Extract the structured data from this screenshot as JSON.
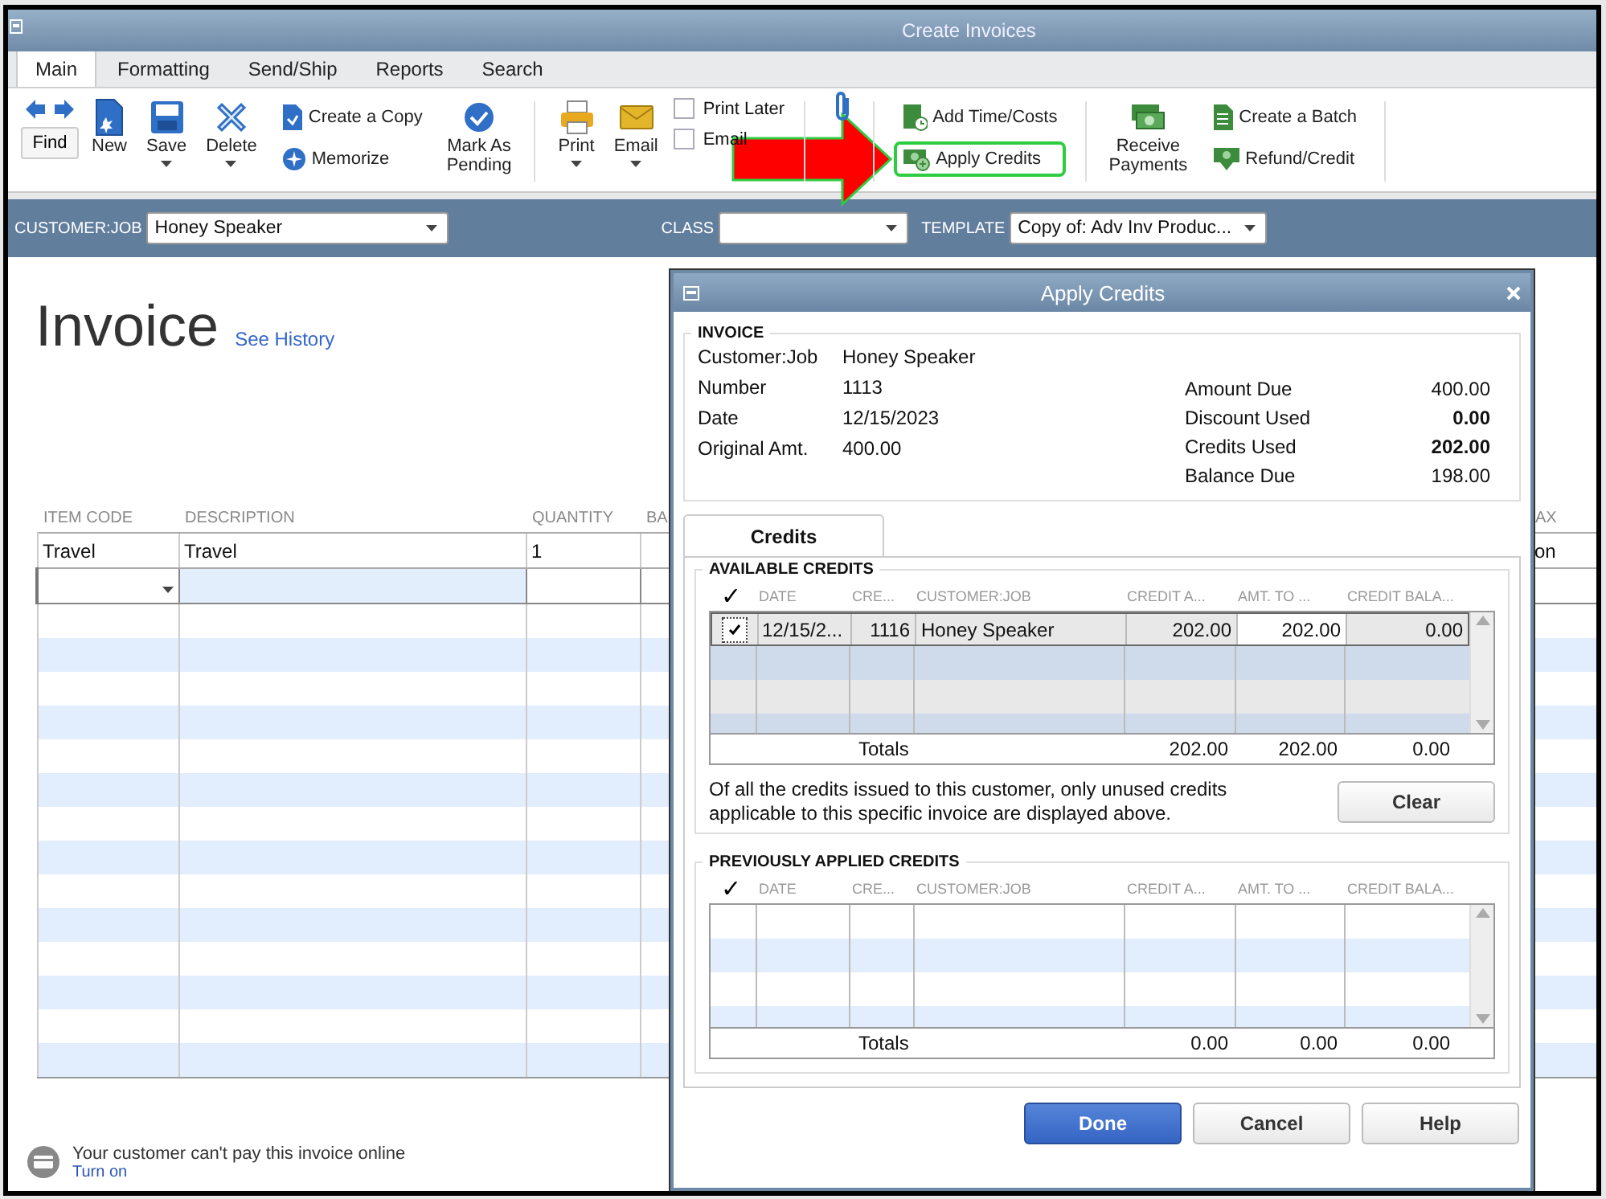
{
  "window": {
    "title": "Create Invoices"
  },
  "tabs": [
    {
      "label": "Main",
      "selected": true
    },
    {
      "label": "Formatting",
      "selected": false
    },
    {
      "label": "Send/Ship",
      "selected": false
    },
    {
      "label": "Reports",
      "selected": false
    },
    {
      "label": "Search",
      "selected": false
    }
  ],
  "toolbar": {
    "items": [
      {
        "kind": "find",
        "label": "Find"
      },
      {
        "kind": "large",
        "label": "New",
        "menu": false
      },
      {
        "kind": "large",
        "label": "Save",
        "menu": true
      },
      {
        "kind": "large",
        "label": "Delete",
        "menu": true
      },
      {
        "kind": "stack",
        "items": [
          {
            "label": "Create a Copy",
            "highlighted": false
          },
          {
            "label": "Memorize",
            "highlighted": false
          }
        ]
      },
      {
        "kind": "large",
        "label": "Mark As Pending",
        "menu": false
      },
      {
        "kind": "separator"
      },
      {
        "kind": "large",
        "label": "Print",
        "menu": true
      },
      {
        "kind": "large",
        "label": "Email",
        "menu": true
      },
      {
        "kind": "checks",
        "items": [
          {
            "label": "Print Later",
            "checked": false
          },
          {
            "label": "Email",
            "checked": false
          }
        ]
      },
      {
        "kind": "separator"
      },
      {
        "kind": "attach"
      },
      {
        "kind": "separator"
      },
      {
        "kind": "stack",
        "items": [
          {
            "label": "Add Time/Costs",
            "highlighted": false
          },
          {
            "label": "Apply Credits",
            "highlighted": true
          }
        ]
      },
      {
        "kind": "separator"
      },
      {
        "kind": "large",
        "label": "Receive Payments",
        "menu": false
      },
      {
        "kind": "stack",
        "items": [
          {
            "label": "Create a Batch",
            "highlighted": false
          },
          {
            "label": "Refund/Credit",
            "highlighted": false
          }
        ]
      },
      {
        "kind": "separator"
      }
    ]
  },
  "customer_bar": {
    "customer_job": {
      "label": "CUSTOMER:JOB",
      "value": "Honey Speaker"
    },
    "class": {
      "label": "CLASS"
    },
    "template": {
      "label": "TEMPLATE",
      "value": "Copy of: Adv Inv Produc..."
    }
  },
  "invoice": {
    "title": "Invoice",
    "history_link": "See History",
    "columns": [
      {
        "label": "ITEM CODE"
      },
      {
        "label": "DESCRIPTION"
      },
      {
        "label": "QUANTITY"
      },
      {
        "label": "BA"
      },
      {
        "label": "AX"
      }
    ],
    "rows": [
      {
        "cells": [
          "Travel",
          "Travel",
          "1",
          null,
          "on"
        ]
      }
    ],
    "footer": {
      "message": "Your customer can't pay this invoice online",
      "link": "Turn on"
    }
  },
  "dialog": {
    "title": "Apply Credits",
    "invoice": {
      "heading": "INVOICE",
      "fields_left": [
        {
          "label": "Customer:Job",
          "value": "Honey Speaker"
        },
        {
          "label": "Number",
          "value": "1113"
        },
        {
          "label": "Date",
          "value": "12/15/2023"
        },
        {
          "label": "Original Amt.",
          "value": "400.00"
        }
      ],
      "fields_right": [
        {
          "label": "Amount Due",
          "value": "400.00",
          "bold": false
        },
        {
          "label": "Discount Used",
          "value": "0.00",
          "bold": true
        },
        {
          "label": "Credits Used",
          "value": "202.00",
          "bold": true
        },
        {
          "label": "Balance Due",
          "value": "198.00",
          "bold": false
        }
      ]
    },
    "tabs": [
      {
        "label": "Credits",
        "selected": true
      }
    ],
    "available": {
      "heading": "AVAILABLE CREDITS",
      "check_header": "✓",
      "columns": [
        "DATE",
        "CRE...",
        "CUSTOMER:JOB",
        "CREDIT A...",
        "AMT. TO ...",
        "CREDIT BALA..."
      ],
      "rows": [
        {
          "checked": true,
          "cells": [
            "12/15/2...",
            "1116",
            "Honey Speaker",
            "202.00",
            "202.00",
            "0.00"
          ]
        }
      ],
      "totals": {
        "label": "Totals",
        "values": [
          "202.00",
          "202.00",
          "0.00"
        ]
      }
    },
    "note": "Of all the credits issued to this customer, only unused credits applicable to this specific invoice are displayed above.",
    "clear_button": "Clear",
    "previous": {
      "heading": "PREVIOUSLY APPLIED CREDITS",
      "check_header": "✓",
      "columns": [
        "DATE",
        "CRE...",
        "CUSTOMER:JOB",
        "CREDIT A...",
        "AMT. TO ...",
        "CREDIT BALA..."
      ],
      "totals": {
        "label": "Totals",
        "values": [
          "0.00",
          "0.00",
          "0.00"
        ]
      }
    },
    "buttons": [
      {
        "label": "Done",
        "kind": "primary"
      },
      {
        "label": "Cancel",
        "kind": "normal"
      },
      {
        "label": "Help",
        "kind": "normal"
      }
    ]
  }
}
